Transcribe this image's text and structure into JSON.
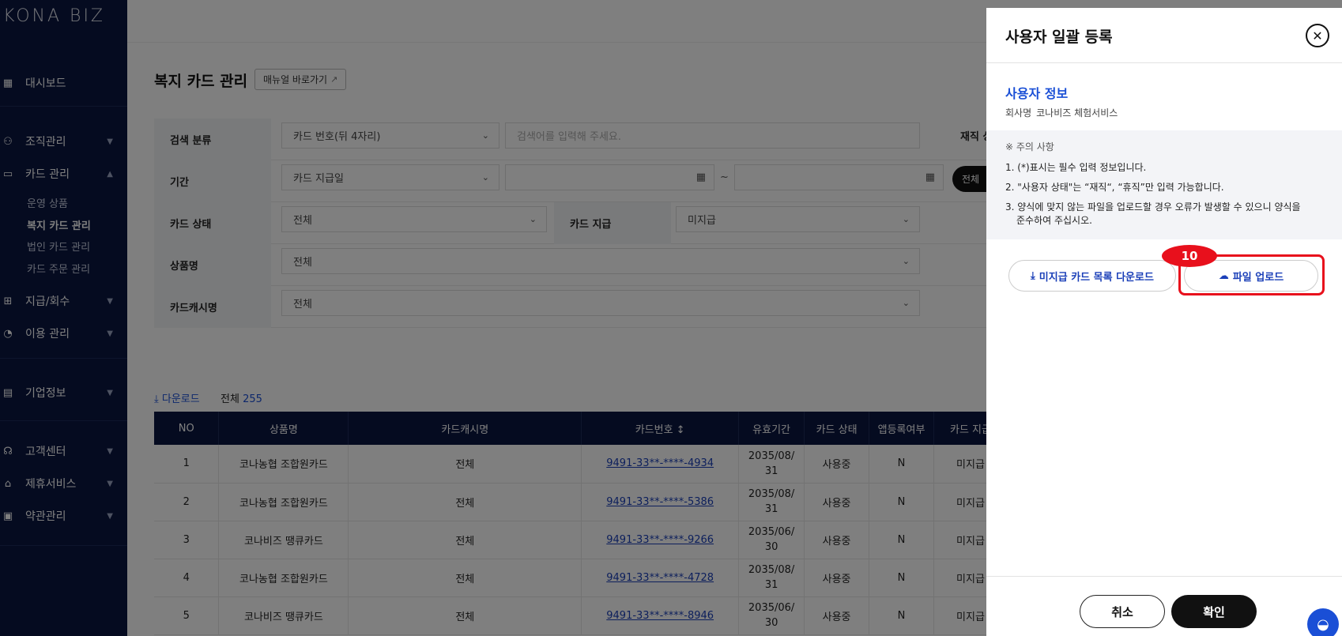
{
  "sidebar": {
    "logo": "KONA BIZ",
    "items": [
      {
        "label": "대시보드",
        "icon": "dashboard-icon"
      },
      {
        "label": "조직관리",
        "icon": "org-icon"
      },
      {
        "label": "카드 관리",
        "icon": "card-icon"
      },
      {
        "label": "지급/회수",
        "icon": "pay-icon"
      },
      {
        "label": "이용 관리",
        "icon": "usage-icon"
      },
      {
        "label": "기업정보",
        "icon": "company-icon"
      },
      {
        "label": "고객센터",
        "icon": "support-icon"
      },
      {
        "label": "제휴서비스",
        "icon": "partner-icon"
      },
      {
        "label": "약관관리",
        "icon": "terms-icon"
      }
    ],
    "card_sub": [
      "운영 상품",
      "복지 카드 관리",
      "법인 카드 관리",
      "카드 주문 관리"
    ]
  },
  "page": {
    "title": "복지 카드 관리",
    "manual_btn": "매뉴얼 바로가기"
  },
  "filter": {
    "search_label": "검색 분류",
    "search_select": "카드 번호(뒤 4자리)",
    "search_placeholder": "검색어를 입력해 주세요.",
    "employ_label": "재직 상",
    "period_label": "기간",
    "period_select": "카드 지급일",
    "tilde": "~",
    "all_btn": "전체",
    "status_label": "카드 상태",
    "status_select": "전체",
    "pay_label": "카드 지급",
    "pay_select": "미지급",
    "product_label": "상품명",
    "product_select": "전체",
    "cashname_label": "카드캐시명",
    "cashname_select": "전체"
  },
  "list": {
    "download": "다운로드",
    "total_label": "전체",
    "total_count": "255",
    "headers": [
      "NO",
      "상품명",
      "카드캐시명",
      "카드번호 ↕",
      "유효기간",
      "카드 상태",
      "앱등록여부",
      "카드 지급"
    ],
    "rows": [
      {
        "no": "1",
        "product": "코나농협 조합원카드",
        "cash": "전체",
        "card": "9491-33**-****-4934",
        "exp1": "2035/08/",
        "exp2": "31",
        "status": "사용중",
        "app": "N",
        "pay": "미지급"
      },
      {
        "no": "2",
        "product": "코나농협 조합원카드",
        "cash": "전체",
        "card": "9491-33**-****-5386",
        "exp1": "2035/08/",
        "exp2": "31",
        "status": "사용중",
        "app": "N",
        "pay": "미지급"
      },
      {
        "no": "3",
        "product": "코나비즈 땡큐카드",
        "cash": "전체",
        "card": "9491-33**-****-9266",
        "exp1": "2035/06/",
        "exp2": "30",
        "status": "사용중",
        "app": "N",
        "pay": "미지급"
      },
      {
        "no": "4",
        "product": "코나농협 조합원카드",
        "cash": "전체",
        "card": "9491-33**-****-4728",
        "exp1": "2035/08/",
        "exp2": "31",
        "status": "사용중",
        "app": "N",
        "pay": "미지급"
      },
      {
        "no": "5",
        "product": "코나비즈 땡큐카드",
        "cash": "전체",
        "card": "9491-33**-****-8946",
        "exp1": "2035/06/",
        "exp2": "30",
        "status": "사용중",
        "app": "N",
        "pay": "미지급"
      }
    ]
  },
  "drawer": {
    "title": "사용자 일괄 등록",
    "section_title": "사용자 정보",
    "company_label": "회사명",
    "company_value": "코나비즈 체험서비스",
    "notice_head": "※ 주의 사항",
    "notice_1": "1. (*)표시는 필수 입력 정보입니다.",
    "notice_2": "2. \"사용자 상태\"는 “재직“, “휴직”만 입력 가능합니다.",
    "notice_3a": "3. 양식에 맞지 않는 파일을 업로드할 경우 오류가 발생할 수 있으니 양식을",
    "notice_3b": "준수하여 주십시오.",
    "download_btn": "미지급 카드 목록 다운로드",
    "upload_btn": "파일 업로드",
    "step_badge": "10",
    "cancel_btn": "취소",
    "ok_btn": "확인"
  },
  "colors": {
    "sidebar_bg": "#0a1741",
    "accent": "#1a4fd6",
    "highlight": "#e8101c"
  }
}
